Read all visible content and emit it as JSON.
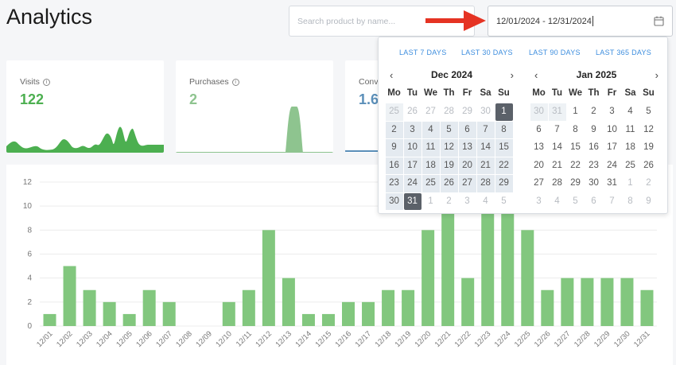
{
  "header": {
    "title": "Analytics"
  },
  "search": {
    "placeholder": "Search product by name..."
  },
  "date_range": {
    "value": "12/01/2024 - 12/31/2024"
  },
  "cards": [
    {
      "label": "Visits",
      "value": "122",
      "color": "#4caf50"
    },
    {
      "label": "Purchases",
      "value": "2",
      "color": "#8ec48f"
    },
    {
      "label": "Conv",
      "value": "1.6",
      "color": "#5b8fb9"
    }
  ],
  "presets": [
    "LAST 7 DAYS",
    "LAST 30 DAYS",
    "LAST 90 DAYS",
    "LAST 365 DAYS"
  ],
  "calendar": {
    "dow": [
      "Mo",
      "Tu",
      "We",
      "Th",
      "Fr",
      "Sa",
      "Su"
    ],
    "months": [
      {
        "title": "Dec 2024",
        "days": [
          [
            "25",
            "offr"
          ],
          [
            "26",
            "off"
          ],
          [
            "27",
            "off"
          ],
          [
            "28",
            "off"
          ],
          [
            "29",
            "off"
          ],
          [
            "30",
            "off"
          ],
          [
            "1",
            "sel"
          ],
          [
            "2",
            "inr"
          ],
          [
            "3",
            "inr"
          ],
          [
            "4",
            "inr"
          ],
          [
            "5",
            "inr"
          ],
          [
            "6",
            "inr"
          ],
          [
            "7",
            "inr"
          ],
          [
            "8",
            "inr"
          ],
          [
            "9",
            "inr"
          ],
          [
            "10",
            "inr"
          ],
          [
            "11",
            "inr"
          ],
          [
            "12",
            "inr"
          ],
          [
            "13",
            "inr"
          ],
          [
            "14",
            "inr"
          ],
          [
            "15",
            "inr"
          ],
          [
            "16",
            "inr"
          ],
          [
            "17",
            "inr"
          ],
          [
            "18",
            "inr"
          ],
          [
            "19",
            "inr"
          ],
          [
            "20",
            "inr"
          ],
          [
            "21",
            "inr"
          ],
          [
            "22",
            "inr"
          ],
          [
            "23",
            "inr"
          ],
          [
            "24",
            "inr"
          ],
          [
            "25",
            "inr"
          ],
          [
            "26",
            "inr"
          ],
          [
            "27",
            "inr"
          ],
          [
            "28",
            "inr"
          ],
          [
            "29",
            "inr"
          ],
          [
            "30",
            "inr"
          ],
          [
            "31",
            "sel"
          ],
          [
            "1",
            "off"
          ],
          [
            "2",
            "off"
          ],
          [
            "3",
            "off"
          ],
          [
            "4",
            "off"
          ],
          [
            "5",
            "off"
          ]
        ]
      },
      {
        "title": "Jan 2025",
        "days": [
          [
            "30",
            "offr"
          ],
          [
            "31",
            "offr"
          ],
          [
            "1",
            ""
          ],
          [
            "2",
            ""
          ],
          [
            "3",
            ""
          ],
          [
            "4",
            ""
          ],
          [
            "5",
            ""
          ],
          [
            "6",
            ""
          ],
          [
            "7",
            ""
          ],
          [
            "8",
            ""
          ],
          [
            "9",
            ""
          ],
          [
            "10",
            ""
          ],
          [
            "11",
            ""
          ],
          [
            "12",
            ""
          ],
          [
            "13",
            ""
          ],
          [
            "14",
            ""
          ],
          [
            "15",
            ""
          ],
          [
            "16",
            ""
          ],
          [
            "17",
            ""
          ],
          [
            "18",
            ""
          ],
          [
            "19",
            ""
          ],
          [
            "20",
            ""
          ],
          [
            "21",
            ""
          ],
          [
            "22",
            ""
          ],
          [
            "23",
            ""
          ],
          [
            "24",
            ""
          ],
          [
            "25",
            ""
          ],
          [
            "26",
            ""
          ],
          [
            "27",
            ""
          ],
          [
            "28",
            ""
          ],
          [
            "29",
            ""
          ],
          [
            "30",
            ""
          ],
          [
            "31",
            ""
          ],
          [
            "1",
            "off"
          ],
          [
            "2",
            "off"
          ],
          [
            "3",
            "off"
          ],
          [
            "4",
            "off"
          ],
          [
            "5",
            "off"
          ],
          [
            "6",
            "off"
          ],
          [
            "7",
            "off"
          ],
          [
            "8",
            "off"
          ],
          [
            "9",
            "off"
          ]
        ]
      }
    ]
  },
  "chart_data": {
    "type": "bar",
    "categories": [
      "12/01",
      "12/02",
      "12/03",
      "12/04",
      "12/05",
      "12/06",
      "12/07",
      "12/08",
      "12/09",
      "12/10",
      "12/11",
      "12/12",
      "12/13",
      "12/14",
      "12/15",
      "12/16",
      "12/17",
      "12/18",
      "12/19",
      "12/20",
      "12/21",
      "12/22",
      "12/23",
      "12/24",
      "12/25",
      "12/26",
      "12/27",
      "12/28",
      "12/29",
      "12/30",
      "12/31"
    ],
    "values": [
      1,
      5,
      3,
      2,
      1,
      3,
      2,
      0,
      0,
      2,
      3,
      8,
      4,
      1,
      1,
      2,
      2,
      3,
      3,
      8,
      13,
      4,
      13,
      11,
      8,
      3,
      4,
      4,
      4,
      4,
      3
    ],
    "yticks": [
      "0",
      "2",
      "4",
      "6",
      "8",
      "10",
      "12"
    ],
    "ylim": [
      0,
      12
    ],
    "grid": true,
    "color": "#82c77e"
  }
}
